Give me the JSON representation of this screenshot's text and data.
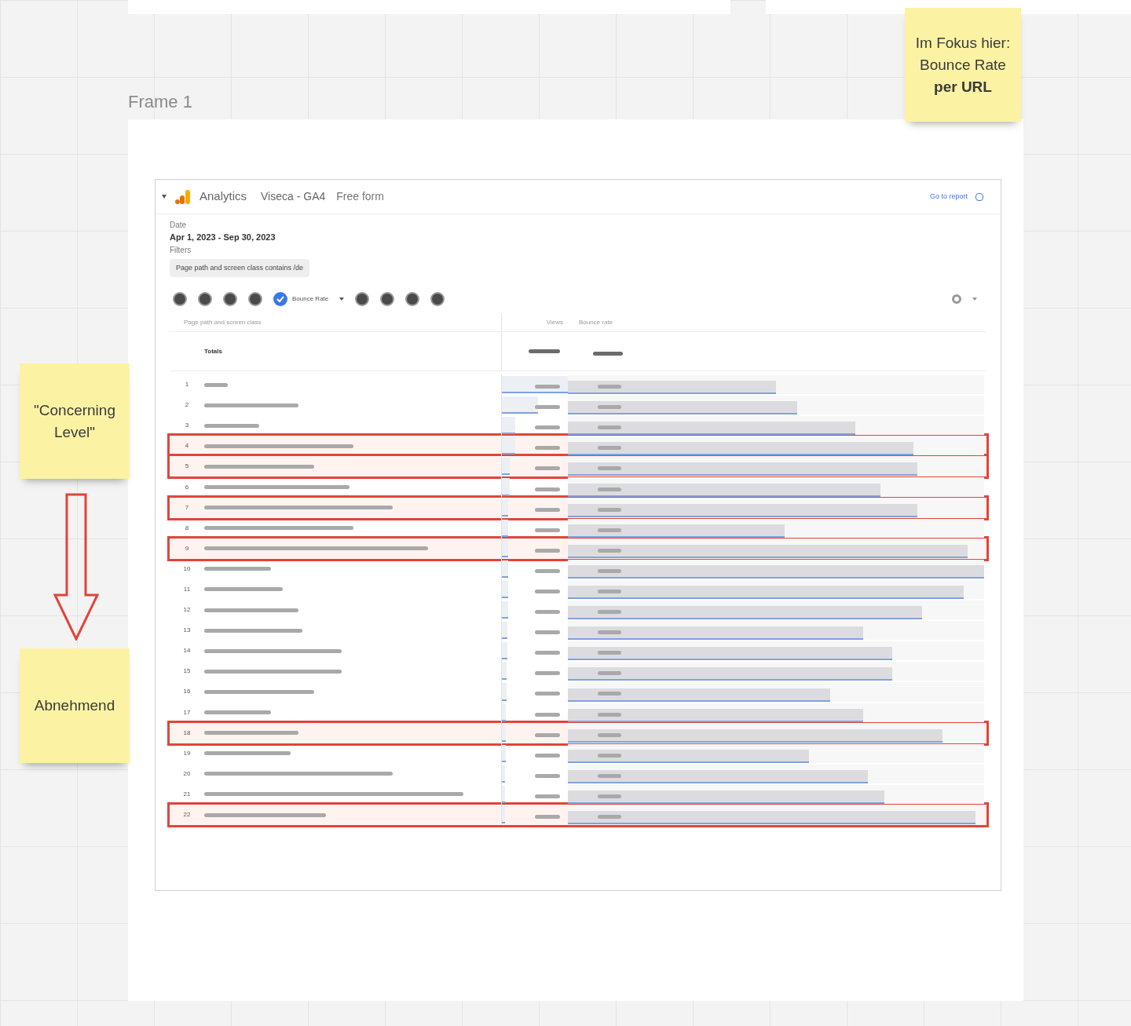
{
  "frame": {
    "title": "Frame 1"
  },
  "sticky_notes": [
    {
      "kind": "top",
      "text": "Im Fokus hier: Bounce Rate **per URL**"
    },
    {
      "kind": "left",
      "text": "\"Concerning Level\""
    },
    {
      "kind": "bottom",
      "text": "Abnehmend"
    }
  ],
  "report": {
    "app": "Analytics",
    "property": "Viseca - GA4",
    "title": "Free form",
    "link": "Go to report",
    "date_label": "Date",
    "date": "Apr 1, 2023 - Sep 30, 2023",
    "filters_label": "Filters",
    "filter": "Page path and screen class contains /de",
    "metric": {
      "label": "Bounce Rate",
      "checked": true
    },
    "columns": [
      "Page path and screen class",
      "Views",
      "Bounce rate"
    ],
    "totals_label": "Totals",
    "rows": [
      {
        "index": "1",
        "highlighted": false,
        "views": {
          "level": 1
        },
        "bounce_rate": {
          "level": 0.5
        }
      },
      {
        "index": "2",
        "highlighted": false,
        "views": {
          "level": 0.55
        },
        "bounce_rate": {
          "level": 0.55
        }
      },
      {
        "index": "3",
        "highlighted": false,
        "views": {
          "level": 0.2
        },
        "bounce_rate": {
          "level": 0.69
        }
      },
      {
        "index": "4",
        "highlighted": true,
        "views": {
          "level": 0.2
        },
        "bounce_rate": {
          "level": 0.83
        }
      },
      {
        "index": "5",
        "highlighted": true,
        "views": {
          "level": 0.12
        },
        "bounce_rate": {
          "level": 0.84
        }
      },
      {
        "index": "6",
        "highlighted": false,
        "views": {
          "level": 0.12
        },
        "bounce_rate": {
          "level": 0.75
        }
      },
      {
        "index": "7",
        "highlighted": true,
        "views": {
          "level": 0.1
        },
        "bounce_rate": {
          "level": 0.84
        }
      },
      {
        "index": "8",
        "highlighted": false,
        "views": {
          "level": 0.1
        },
        "bounce_rate": {
          "level": 0.52
        }
      },
      {
        "index": "9",
        "highlighted": true,
        "views": {
          "level": 0.1
        },
        "bounce_rate": {
          "level": 0.96
        }
      },
      {
        "index": "10",
        "highlighted": false,
        "views": {
          "level": 0.09
        },
        "bounce_rate": {
          "level": 1
        }
      },
      {
        "index": "11",
        "highlighted": false,
        "views": {
          "level": 0.09
        },
        "bounce_rate": {
          "level": 0.95
        }
      },
      {
        "index": "12",
        "highlighted": false,
        "views": {
          "level": 0.09
        },
        "bounce_rate": {
          "level": 0.85
        }
      },
      {
        "index": "13",
        "highlighted": false,
        "views": {
          "level": 0.08
        },
        "bounce_rate": {
          "level": 0.71
        }
      },
      {
        "index": "14",
        "highlighted": false,
        "views": {
          "level": 0.08
        },
        "bounce_rate": {
          "level": 0.78
        }
      },
      {
        "index": "15",
        "highlighted": false,
        "views": {
          "level": 0.07
        },
        "bounce_rate": {
          "level": 0.78
        }
      },
      {
        "index": "16",
        "highlighted": false,
        "views": {
          "level": 0.07
        },
        "bounce_rate": {
          "level": 0.63
        }
      },
      {
        "index": "17",
        "highlighted": false,
        "views": {
          "level": 0.06
        },
        "bounce_rate": {
          "level": 0.71
        }
      },
      {
        "index": "18",
        "highlighted": true,
        "views": {
          "level": 0.06
        },
        "bounce_rate": {
          "level": 0.9
        }
      },
      {
        "index": "19",
        "highlighted": false,
        "views": {
          "level": 0.06
        },
        "bounce_rate": {
          "level": 0.58
        }
      },
      {
        "index": "20",
        "highlighted": false,
        "views": {
          "level": 0.05
        },
        "bounce_rate": {
          "level": 0.72
        }
      },
      {
        "index": "21",
        "highlighted": false,
        "views": {
          "level": 0.05
        },
        "bounce_rate": {
          "level": 0.76
        }
      },
      {
        "index": "22",
        "highlighted": true,
        "views": {
          "level": 0.05
        },
        "bounce_rate": {
          "level": 0.98
        }
      }
    ]
  }
}
